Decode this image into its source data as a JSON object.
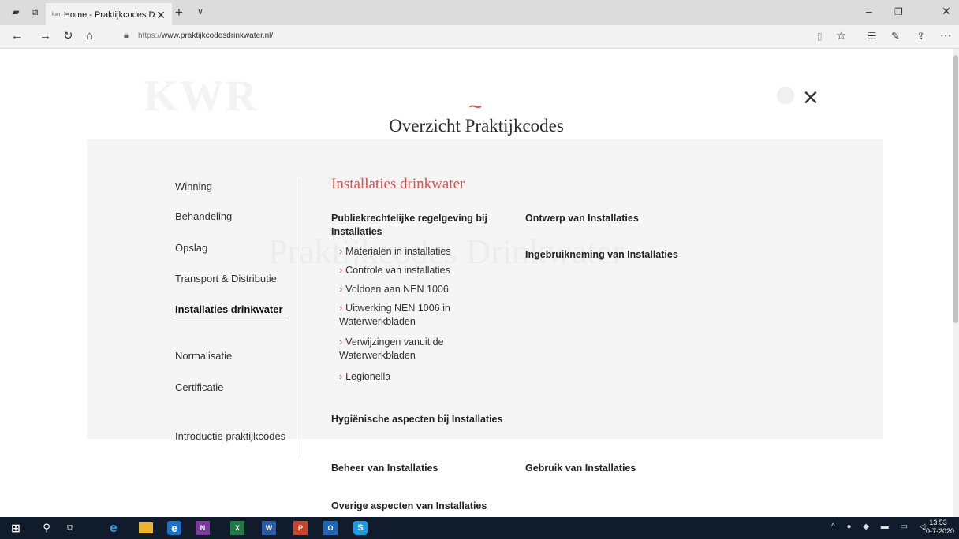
{
  "browser": {
    "tab_title": "Home - Praktijkcodes D",
    "tab_favicon": "kwr",
    "url_prefix": "https://",
    "url_rest": "www.praktijkcodesdrinkwater.nl/"
  },
  "overlay": {
    "wave": "~",
    "title": "Overzicht Praktijkcodes",
    "close": "×"
  },
  "side_menu": [
    "Winning",
    "Behandeling",
    "Opslag",
    "Transport & Distributie",
    "Installaties drinkwater",
    "Normalisatie",
    "Certificatie",
    "Introductie praktijkcodes"
  ],
  "section": {
    "title": "Installaties drinkwater",
    "cat_publiek": "Publiekrechtelijke regelgeving bij Installaties",
    "subs": [
      "Materialen in installaties",
      "Controle van installaties",
      "Voldoen aan NEN 1006",
      "Uitwerking NEN 1006 in Waterwerkbladen",
      "Verwijzingen vanuit de Waterwerkbladen",
      "Legionella"
    ],
    "cat_ontwerp": "Ontwerp van Installaties",
    "cat_ingebruik": "Ingebruikneming van Installaties",
    "cat_hygiene": "Hygiënische aspecten bij Installaties",
    "cat_beheer": "Beheer van Installaties",
    "cat_gebruik": "Gebruik van Installaties",
    "cat_overige": "Overige aspecten van Installaties"
  },
  "background": {
    "logo": "KWR",
    "hero": "Praktijkcodes Drinkwater"
  },
  "taskbar": {
    "time": "13:53",
    "date": "10-7-2020"
  },
  "colors": {
    "accent": "#d9524f",
    "taskbar": "#101b2b"
  }
}
